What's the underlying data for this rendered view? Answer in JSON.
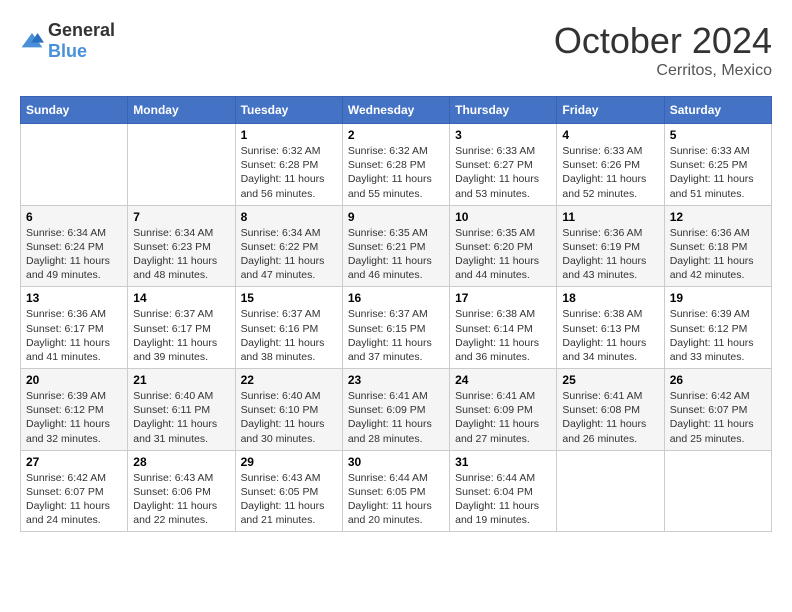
{
  "logo": {
    "general": "General",
    "blue": "Blue"
  },
  "header": {
    "month": "October 2024",
    "location": "Cerritos, Mexico"
  },
  "weekdays": [
    "Sunday",
    "Monday",
    "Tuesday",
    "Wednesday",
    "Thursday",
    "Friday",
    "Saturday"
  ],
  "weeks": [
    [
      {
        "day": "",
        "data": ""
      },
      {
        "day": "",
        "data": ""
      },
      {
        "day": "1",
        "data": "Sunrise: 6:32 AM\nSunset: 6:28 PM\nDaylight: 11 hours and 56 minutes."
      },
      {
        "day": "2",
        "data": "Sunrise: 6:32 AM\nSunset: 6:28 PM\nDaylight: 11 hours and 55 minutes."
      },
      {
        "day": "3",
        "data": "Sunrise: 6:33 AM\nSunset: 6:27 PM\nDaylight: 11 hours and 53 minutes."
      },
      {
        "day": "4",
        "data": "Sunrise: 6:33 AM\nSunset: 6:26 PM\nDaylight: 11 hours and 52 minutes."
      },
      {
        "day": "5",
        "data": "Sunrise: 6:33 AM\nSunset: 6:25 PM\nDaylight: 11 hours and 51 minutes."
      }
    ],
    [
      {
        "day": "6",
        "data": "Sunrise: 6:34 AM\nSunset: 6:24 PM\nDaylight: 11 hours and 49 minutes."
      },
      {
        "day": "7",
        "data": "Sunrise: 6:34 AM\nSunset: 6:23 PM\nDaylight: 11 hours and 48 minutes."
      },
      {
        "day": "8",
        "data": "Sunrise: 6:34 AM\nSunset: 6:22 PM\nDaylight: 11 hours and 47 minutes."
      },
      {
        "day": "9",
        "data": "Sunrise: 6:35 AM\nSunset: 6:21 PM\nDaylight: 11 hours and 46 minutes."
      },
      {
        "day": "10",
        "data": "Sunrise: 6:35 AM\nSunset: 6:20 PM\nDaylight: 11 hours and 44 minutes."
      },
      {
        "day": "11",
        "data": "Sunrise: 6:36 AM\nSunset: 6:19 PM\nDaylight: 11 hours and 43 minutes."
      },
      {
        "day": "12",
        "data": "Sunrise: 6:36 AM\nSunset: 6:18 PM\nDaylight: 11 hours and 42 minutes."
      }
    ],
    [
      {
        "day": "13",
        "data": "Sunrise: 6:36 AM\nSunset: 6:17 PM\nDaylight: 11 hours and 41 minutes."
      },
      {
        "day": "14",
        "data": "Sunrise: 6:37 AM\nSunset: 6:17 PM\nDaylight: 11 hours and 39 minutes."
      },
      {
        "day": "15",
        "data": "Sunrise: 6:37 AM\nSunset: 6:16 PM\nDaylight: 11 hours and 38 minutes."
      },
      {
        "day": "16",
        "data": "Sunrise: 6:37 AM\nSunset: 6:15 PM\nDaylight: 11 hours and 37 minutes."
      },
      {
        "day": "17",
        "data": "Sunrise: 6:38 AM\nSunset: 6:14 PM\nDaylight: 11 hours and 36 minutes."
      },
      {
        "day": "18",
        "data": "Sunrise: 6:38 AM\nSunset: 6:13 PM\nDaylight: 11 hours and 34 minutes."
      },
      {
        "day": "19",
        "data": "Sunrise: 6:39 AM\nSunset: 6:12 PM\nDaylight: 11 hours and 33 minutes."
      }
    ],
    [
      {
        "day": "20",
        "data": "Sunrise: 6:39 AM\nSunset: 6:12 PM\nDaylight: 11 hours and 32 minutes."
      },
      {
        "day": "21",
        "data": "Sunrise: 6:40 AM\nSunset: 6:11 PM\nDaylight: 11 hours and 31 minutes."
      },
      {
        "day": "22",
        "data": "Sunrise: 6:40 AM\nSunset: 6:10 PM\nDaylight: 11 hours and 30 minutes."
      },
      {
        "day": "23",
        "data": "Sunrise: 6:41 AM\nSunset: 6:09 PM\nDaylight: 11 hours and 28 minutes."
      },
      {
        "day": "24",
        "data": "Sunrise: 6:41 AM\nSunset: 6:09 PM\nDaylight: 11 hours and 27 minutes."
      },
      {
        "day": "25",
        "data": "Sunrise: 6:41 AM\nSunset: 6:08 PM\nDaylight: 11 hours and 26 minutes."
      },
      {
        "day": "26",
        "data": "Sunrise: 6:42 AM\nSunset: 6:07 PM\nDaylight: 11 hours and 25 minutes."
      }
    ],
    [
      {
        "day": "27",
        "data": "Sunrise: 6:42 AM\nSunset: 6:07 PM\nDaylight: 11 hours and 24 minutes."
      },
      {
        "day": "28",
        "data": "Sunrise: 6:43 AM\nSunset: 6:06 PM\nDaylight: 11 hours and 22 minutes."
      },
      {
        "day": "29",
        "data": "Sunrise: 6:43 AM\nSunset: 6:05 PM\nDaylight: 11 hours and 21 minutes."
      },
      {
        "day": "30",
        "data": "Sunrise: 6:44 AM\nSunset: 6:05 PM\nDaylight: 11 hours and 20 minutes."
      },
      {
        "day": "31",
        "data": "Sunrise: 6:44 AM\nSunset: 6:04 PM\nDaylight: 11 hours and 19 minutes."
      },
      {
        "day": "",
        "data": ""
      },
      {
        "day": "",
        "data": ""
      }
    ]
  ]
}
